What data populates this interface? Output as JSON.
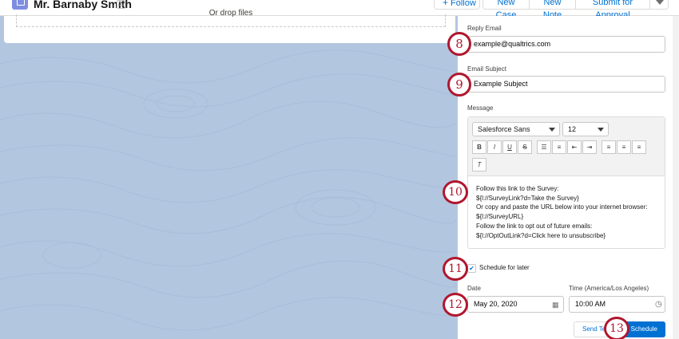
{
  "header": {
    "record_title": "Mr. Barnaby Smith",
    "buttons": {
      "follow": "Follow",
      "new_case": "New Case",
      "new_note": "New Note",
      "submit": "Submit for Approval"
    }
  },
  "upload": {
    "drop_text": "Or drop files"
  },
  "form": {
    "reply_email": {
      "label": "Reply Email",
      "value": "example@qualtrics.com"
    },
    "email_subject": {
      "label": "Email Subject",
      "value": "Example Subject"
    },
    "message": {
      "label": "Message",
      "font_family": "Salesforce Sans",
      "font_size": "12",
      "toolbar": {
        "bold": "B",
        "italic": "I",
        "underline": "U",
        "strike": "S",
        "clear": "T"
      },
      "lines": [
        "Follow this link to the Survey:",
        "${l://SurveyLink?d=Take the Survey}",
        "Or copy and paste the URL below into your internet browser:",
        "${l://SurveyURL}",
        "Follow the link to opt out of future emails:",
        "${l://OptOutLink?d=Click here to unsubscribe}"
      ]
    },
    "schedule": {
      "label": "Schedule for later",
      "checked": true
    },
    "date": {
      "label": "Date",
      "value": "May 20, 2020"
    },
    "time": {
      "label": "Time (America/Los Angeles)",
      "value": "10:00 AM"
    },
    "send_label": "Send Test",
    "schedule_label": "Schedule"
  },
  "steps": [
    "8",
    "9",
    "10",
    "11",
    "12",
    "13"
  ],
  "colors": {
    "accent": "#0070d2",
    "badge": "#b0172e",
    "background": "#b0c4df"
  }
}
